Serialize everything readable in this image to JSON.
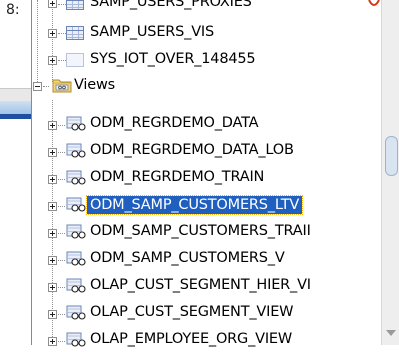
{
  "left_pane": {
    "label": "8:"
  },
  "tree": {
    "tables_tail": [
      {
        "label": "SAMP_USERS_PROXIES"
      },
      {
        "label": "SAMP_USERS_VIS"
      },
      {
        "label": "SYS_IOT_OVER_148455"
      }
    ],
    "views_folder": {
      "label": "Views"
    },
    "views": [
      {
        "label": "ODM_REGRDEMO_DATA"
      },
      {
        "label": "ODM_REGRDEMO_DATA_LOB"
      },
      {
        "label": "ODM_REGRDEMO_TRAIN"
      },
      {
        "label": "ODM_SAMP_CUSTOMERS_LTV",
        "selected": true
      },
      {
        "label": "ODM_SAMP_CUSTOMERS_TRAII"
      },
      {
        "label": "ODM_SAMP_CUSTOMERS_V"
      },
      {
        "label": "OLAP_CUST_SEGMENT_HIER_VI"
      },
      {
        "label": "OLAP_CUST_SEGMENT_VIEW"
      },
      {
        "label": "OLAP_EMPLOYEE_ORG_VIEW"
      }
    ]
  },
  "colors": {
    "selection": "#1f5fbf",
    "table_icon": "#6b84b6",
    "folder": "#e8c45a"
  }
}
